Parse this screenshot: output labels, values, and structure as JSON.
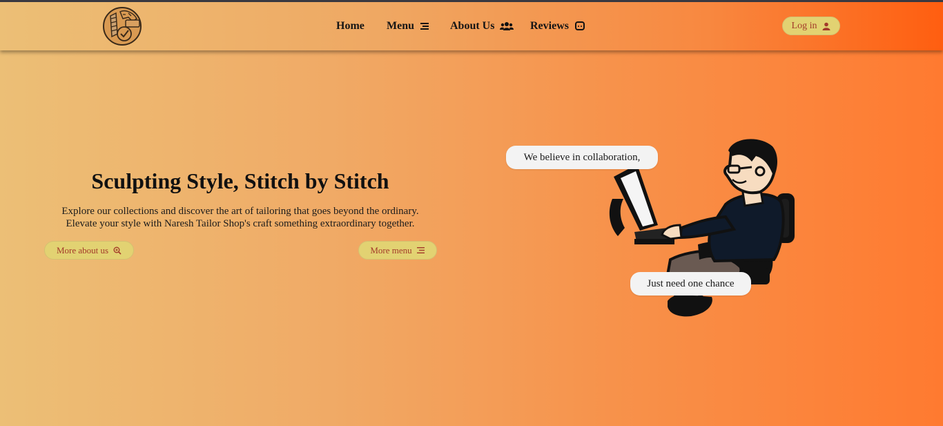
{
  "nav": {
    "home": "Home",
    "menu": "Menu",
    "about": "About Us",
    "reviews": "Reviews",
    "login": "Log in"
  },
  "hero": {
    "title": "Sculpting Style, Stitch by Stitch",
    "line1": "Explore our collections and discover the art of tailoring that goes beyond the ordinary.",
    "line2": "Elevate your style with Naresh Tailor Shop's craft something extraordinary together.",
    "btn_about": "More about us",
    "btn_menu": "More menu"
  },
  "bubbles": {
    "first": "We believe in collaboration,",
    "second": "Just need one chance"
  },
  "icons": {
    "menu": "list-icon",
    "about": "users-icon",
    "reviews": "chat-icon",
    "login": "user-icon",
    "about_btn": "search-plus-icon",
    "menu_btn": "list-icon"
  },
  "colors": {
    "button_bg": "#e2d272",
    "button_text": "#a33a2a",
    "accent": "#ff6a1a"
  }
}
